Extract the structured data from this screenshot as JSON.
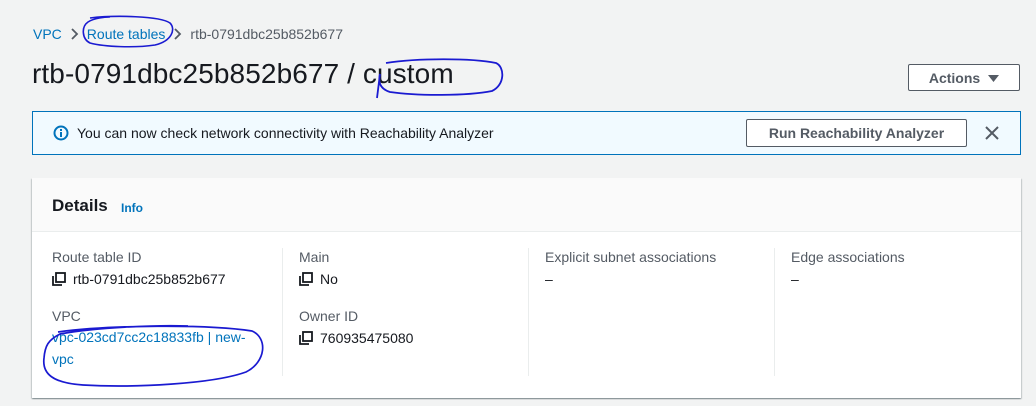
{
  "breadcrumb": {
    "root": "VPC",
    "section": "Route tables",
    "current": "rtb-0791dbc25b852b677"
  },
  "page": {
    "title": "rtb-0791dbc25b852b677 / custom"
  },
  "header": {
    "actions_label": "Actions"
  },
  "alert": {
    "text": "You can now check network connectivity with Reachability Analyzer",
    "button_label": "Run Reachability Analyzer"
  },
  "details": {
    "title": "Details",
    "info_label": "Info",
    "route_table_id_label": "Route table ID",
    "route_table_id": "rtb-0791dbc25b852b677",
    "vpc_label": "VPC",
    "vpc_value_line1": "vpc-023cd7cc2c18833fb | new-",
    "vpc_value_line2": "vpc",
    "main_label": "Main",
    "main_value": "No",
    "owner_id_label": "Owner ID",
    "owner_id": "760935475080",
    "explicit_subnet_label": "Explicit subnet associations",
    "explicit_subnet_value": "–",
    "edge_label": "Edge associations",
    "edge_value": "–"
  },
  "colors": {
    "link": "#0073bb",
    "alert_border": "#0073bb",
    "alert_bg": "#f1faff",
    "annotation_ink": "#1a1ad1"
  }
}
